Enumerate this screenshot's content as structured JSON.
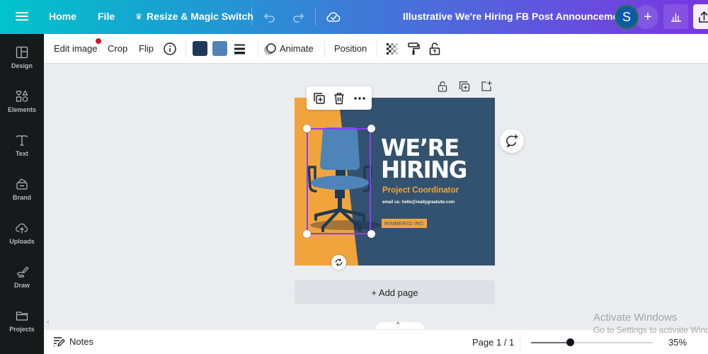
{
  "topbar": {
    "home": "Home",
    "file": "File",
    "resize": "Resize & Magic Switch",
    "title": "Illustrative We're Hiring FB Post Announcement",
    "avatar_initial": "S",
    "add_label": "+"
  },
  "sidebar": {
    "items": [
      {
        "label": "Design",
        "icon": "layout-icon"
      },
      {
        "label": "Elements",
        "icon": "shapes-icon"
      },
      {
        "label": "Text",
        "icon": "text-icon"
      },
      {
        "label": "Brand",
        "icon": "brand-icon"
      },
      {
        "label": "Uploads",
        "icon": "cloud-upload-icon"
      },
      {
        "label": "Draw",
        "icon": "draw-icon"
      },
      {
        "label": "Projects",
        "icon": "folder-icon"
      }
    ]
  },
  "contextbar": {
    "edit_image": "Edit image",
    "crop": "Crop",
    "flip": "Flip",
    "animate": "Animate",
    "position": "Position",
    "swatches": [
      "#1e3a56",
      "#4e84b8"
    ]
  },
  "design": {
    "headline_line1": "WE’RE",
    "headline_line2": "HIRING",
    "role": "Project Coordinator",
    "email": "email us: hello@reallygreatsite.com",
    "company": "RIMBERIO INC",
    "colors": {
      "navy": "#33526f",
      "orange": "#f2a43c",
      "chair_light": "#4e84b8",
      "chair_dark": "#1e3a56"
    }
  },
  "canvas": {
    "add_page": "+ Add page"
  },
  "bottombar": {
    "notes": "Notes",
    "page": "Page 1 / 1",
    "zoom_percent": 35,
    "zoom_label": "35%",
    "zoom_slider_fraction": 0.32
  },
  "watermark": {
    "line1": "Activate Windows",
    "line2": "Go to Settings to activate Windows."
  }
}
